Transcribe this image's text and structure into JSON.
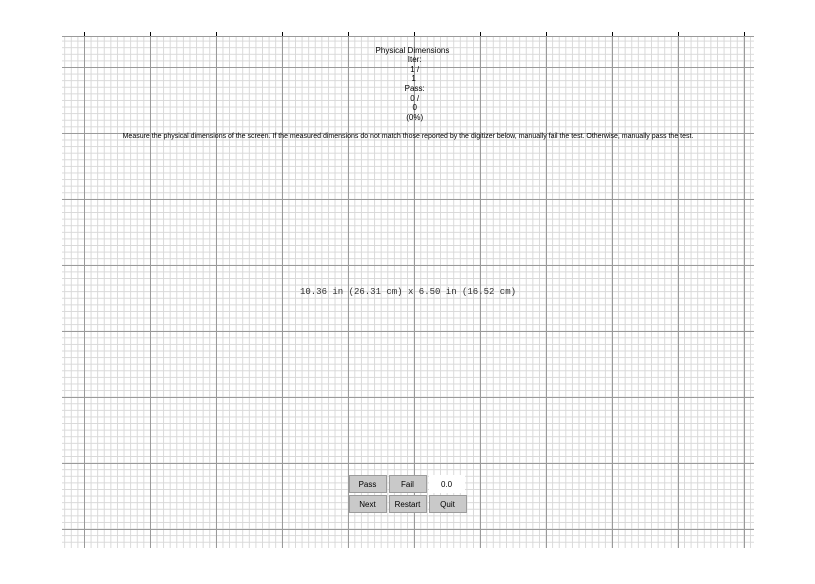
{
  "header": {
    "title": "Physical Dimensions",
    "iter_label": "Iter:",
    "iter_current": 1,
    "iter_total": 1,
    "pass_label": "Pass:",
    "pass_count": 0,
    "pass_total": 0,
    "pass_pct": "0%",
    "instructions": "Measure the physical dimensions of the screen. If the measured dimensions do not match those reported by the digitizer below, manually fail the test. Otherwise, manually pass the test."
  },
  "measurement": {
    "width_in": "10.36",
    "width_cm": "26.31",
    "height_in": "6.50",
    "height_cm": "16.52",
    "display": "10.36 in (26.31 cm) x 6.50 in (16.52 cm)"
  },
  "controls": {
    "pass": "Pass",
    "fail": "Fail",
    "value": "0.0",
    "next": "Next",
    "restart": "Restart",
    "quit": "Quit"
  }
}
